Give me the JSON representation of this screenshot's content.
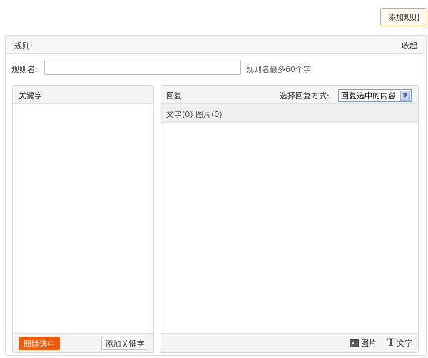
{
  "toolbar": {
    "add_rule_label": "添加规则"
  },
  "rule": {
    "title": "规则:",
    "collapse_label": "收起",
    "name_label": "规则名:",
    "name_value": "",
    "name_hint": "规则名最多60个字"
  },
  "keywords": {
    "header": "关键字",
    "delete_label": "删除选中",
    "add_label": "添加关键字"
  },
  "reply": {
    "header": "回复",
    "mode_label": "选择回复方式:",
    "mode_selected": "回复选中的内容",
    "counts": "文字(0) 图片(0)",
    "image_label": "图片",
    "text_label": "文字"
  },
  "icons": {
    "image": "image-icon",
    "text": "text-icon",
    "dropdown": "chevron-down-icon"
  },
  "colors": {
    "delete_button": "#ef5a0c",
    "add_rule_border": "#e0b060"
  }
}
